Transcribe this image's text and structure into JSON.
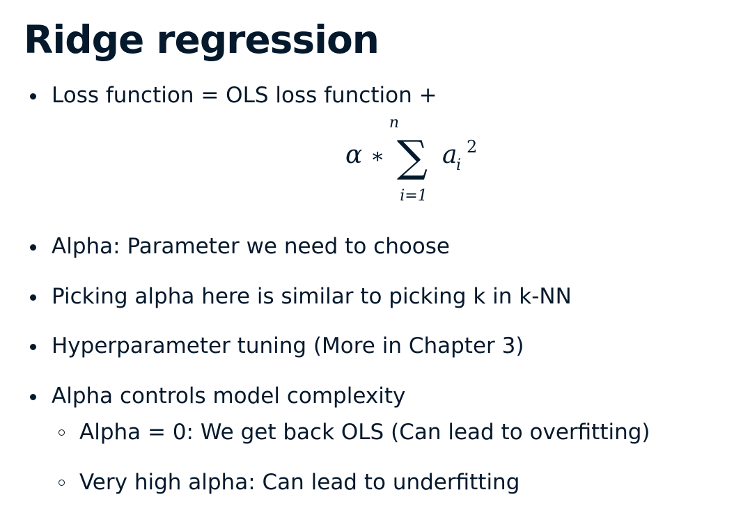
{
  "slide": {
    "title": "Ridge regression",
    "bullets": [
      "Loss function = OLS loss function +",
      "Alpha: Parameter we need to choose",
      "Picking alpha here is similar to picking k in k-NN",
      "Hyperparameter tuning (More in Chapter 3)",
      "Alpha controls model complexity"
    ],
    "sub_bullets": [
      "Alpha = 0: We get back OLS (Can lead to overfitting)",
      "Very high alpha: Can lead to underfitting"
    ],
    "formula": {
      "alpha": "α",
      "times": "∗",
      "sum": "∑",
      "upper": "n",
      "lower": "i=1",
      "base": "a",
      "subscript": "i",
      "exponent": "2"
    }
  }
}
